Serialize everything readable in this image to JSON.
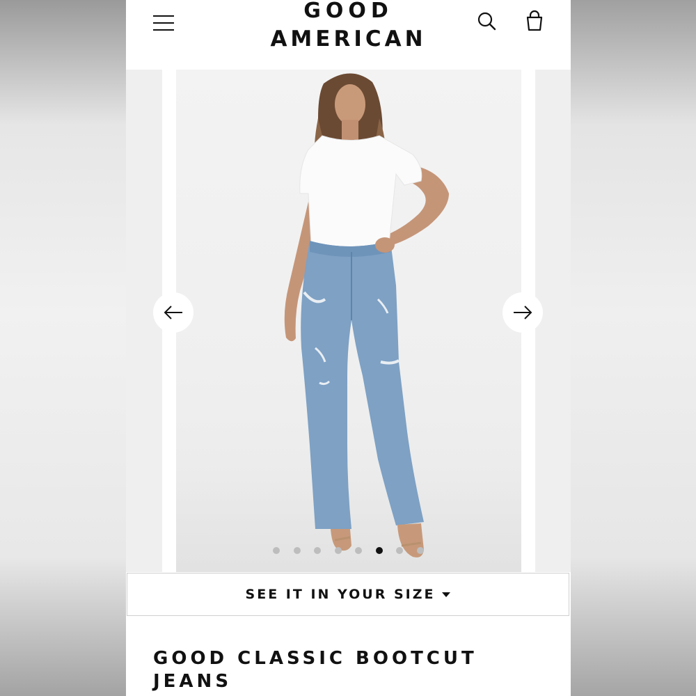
{
  "brand": {
    "line1": "GOOD",
    "line2": "AMERICAN"
  },
  "header": {
    "menu_icon": "hamburger-menu-icon",
    "search_icon": "search-icon",
    "bag_icon": "shopping-bag-icon"
  },
  "carousel": {
    "prev_icon": "arrow-left-icon",
    "next_icon": "arrow-right-icon",
    "image_description_icon": "model-photo",
    "dot_count": 8,
    "active_dot_index": 5
  },
  "size_button": {
    "label": "SEE IT IN YOUR SIZE"
  },
  "product": {
    "title": "GOOD CLASSIC BOOTCUT JEANS"
  },
  "colors": {
    "text": "#111111",
    "dot": "#bdbdbd",
    "denim": "#7ea1c4"
  }
}
